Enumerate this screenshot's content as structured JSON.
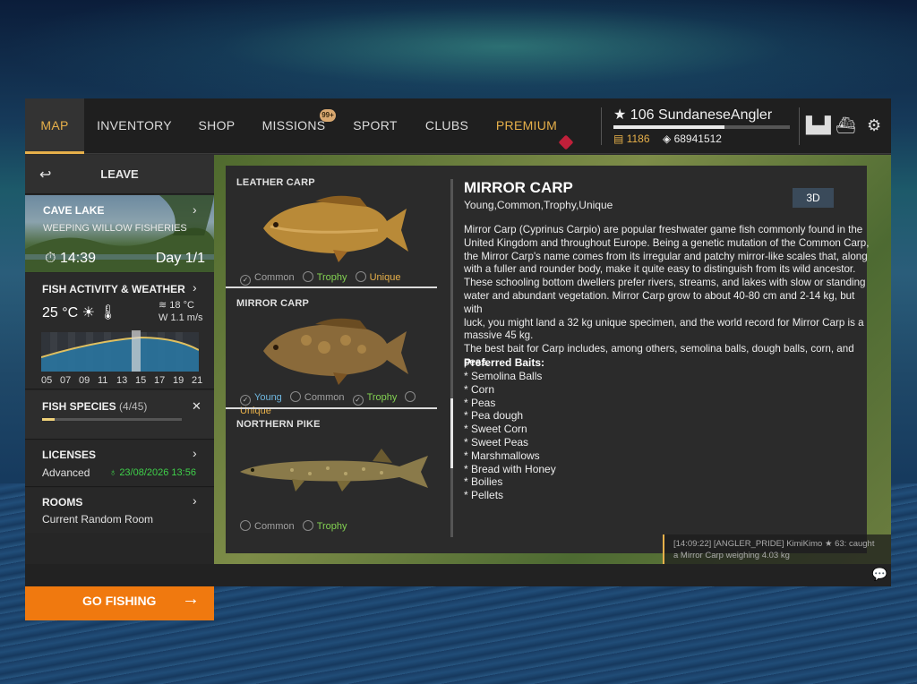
{
  "nav": {
    "tabs": [
      {
        "label": "MAP",
        "active": true
      },
      {
        "label": "INVENTORY"
      },
      {
        "label": "SHOP"
      },
      {
        "label": "MISSIONS",
        "badge": "99+"
      },
      {
        "label": "SPORT"
      },
      {
        "label": "CLUBS"
      },
      {
        "label": "PREMIUM"
      }
    ]
  },
  "player": {
    "name": "106 SundaneseAngler",
    "xp_progress": 0.63,
    "gold": "1186",
    "silver": "68941512",
    "icons": [
      "leaderboard-icon",
      "ship-icon",
      "settings-icon"
    ]
  },
  "sidebar": {
    "leave": "LEAVE",
    "location": {
      "title": "CAVE LAKE",
      "subtitle": "WEEPING WILLOW FISHERIES",
      "time": "14:39",
      "day": "Day 1/1"
    },
    "weather": {
      "title": "FISH ACTIVITY & WEATHER",
      "temp": "25 °C",
      "water_temp": "18 °C",
      "wind": "W 1.1 m/s",
      "hours": [
        "05",
        "07",
        "09",
        "11",
        "13",
        "15",
        "17",
        "19",
        "21"
      ]
    },
    "species": {
      "title": "FISH SPECIES",
      "count": "(4/45)",
      "progress": 0.089
    },
    "licenses": {
      "title": "LICENSES",
      "value": "Advanced",
      "expires": "23/08/2026 13:56"
    },
    "rooms": {
      "title": "ROOMS",
      "value": "Current Random Room"
    },
    "go_fishing": "GO FISHING"
  },
  "fish_list": [
    {
      "name": "LEATHER CARP",
      "options": [
        {
          "label": "Common",
          "checked": true,
          "kind": "common"
        },
        {
          "label": "Trophy",
          "checked": false,
          "kind": "trophy"
        },
        {
          "label": "Unique",
          "checked": false,
          "kind": "unique"
        }
      ]
    },
    {
      "name": "MIRROR CARP",
      "options": [
        {
          "label": "Young",
          "checked": true,
          "kind": "young"
        },
        {
          "label": "Common",
          "checked": false,
          "kind": "common"
        },
        {
          "label": "Trophy",
          "checked": true,
          "kind": "trophy"
        },
        {
          "label": "Unique",
          "checked": false,
          "kind": "unique"
        }
      ]
    },
    {
      "name": "NORTHERN PIKE",
      "options": [
        {
          "label": "Common",
          "checked": false,
          "kind": "common"
        },
        {
          "label": "Trophy",
          "checked": false,
          "kind": "trophy"
        }
      ]
    }
  ],
  "detail": {
    "title": "MIRROR CARP",
    "subtitle": "Young,Common,Trophy,Unique",
    "button_3d": "3D",
    "description_lines": [
      "Mirror Carp (Cyprinus Carpio) are popular freshwater game fish commonly found in the",
      "United Kingdom and throughout Europe. Being a genetic mutation of the Common Carp,",
      "the Mirror Carp's name comes from its irregular and patchy mirror-like scales that, along",
      "with a fuller and rounder body, make it quite easy to distinguish from its wild ancestor.",
      "These schooling bottom dwellers prefer rivers, streams, and lakes with slow or standing",
      "water and abundant vegetation. Mirror Carp grow to about 40-80 cm and 2-14 kg, but with",
      "luck, you might land a 32 kg unique specimen, and the world record for Mirror Carp is a",
      "massive 45 kg.",
      "The best bait for Carp includes, among others, semolina balls, dough balls, corn, and peas."
    ],
    "baits_title": "Preferred Baits:",
    "baits": [
      "* Semolina Balls",
      "* Corn",
      "* Peas",
      "* Pea dough",
      "* Sweet Corn",
      "* Sweet Peas",
      "* Marshmallows",
      "* Bread with Honey",
      "* Boilies",
      "* Pellets"
    ]
  },
  "chat": {
    "line1": "[14:09:22] [ANGLER_PRIDE] KimiKimo ★ 63: caught",
    "line2": "a Mirror Carp weighing 4.03 kg"
  }
}
